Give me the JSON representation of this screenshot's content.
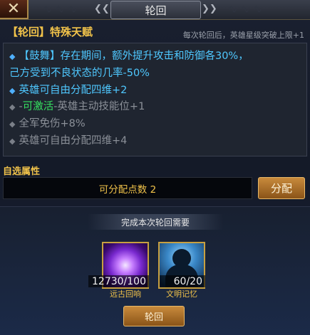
{
  "window": {
    "title": "轮回",
    "close_glyph": "✕"
  },
  "talent": {
    "title": "【轮回】特殊天赋",
    "hint": "每次轮回后，英雄星级突破上限+1"
  },
  "effects": {
    "drum_label": "【鼓舞】",
    "drum_desc": "存在期间，额外提升攻击和防御各30%，",
    "drum_desc2": "己方受到不良状态的几率-50%",
    "stat_free": "英雄可自由分配四维+2",
    "activate_prefix": "-",
    "activate_text": "可激活",
    "activate_suffix": "-英雄主动技能位+1",
    "army_immunity": "全军免伤+8%",
    "stat_free_2": "英雄可自由分配四维+4"
  },
  "attributes": {
    "label": "自选属性",
    "points_text": "可分配点数 2",
    "assign_button": "分配"
  },
  "requirements": {
    "banner": "完成本次轮回需要",
    "items": [
      {
        "name": "远古回响",
        "count": "12730/100",
        "icon": "purple-orb-icon"
      },
      {
        "name": "文明记忆",
        "count": "60/20",
        "icon": "silhouette-icon"
      }
    ],
    "rebirth_button": "轮回"
  },
  "colors": {
    "gold": "#f0c24a",
    "active_blue": "#4fc8ff",
    "green": "#35e060",
    "inactive_gray": "#8b9098"
  }
}
